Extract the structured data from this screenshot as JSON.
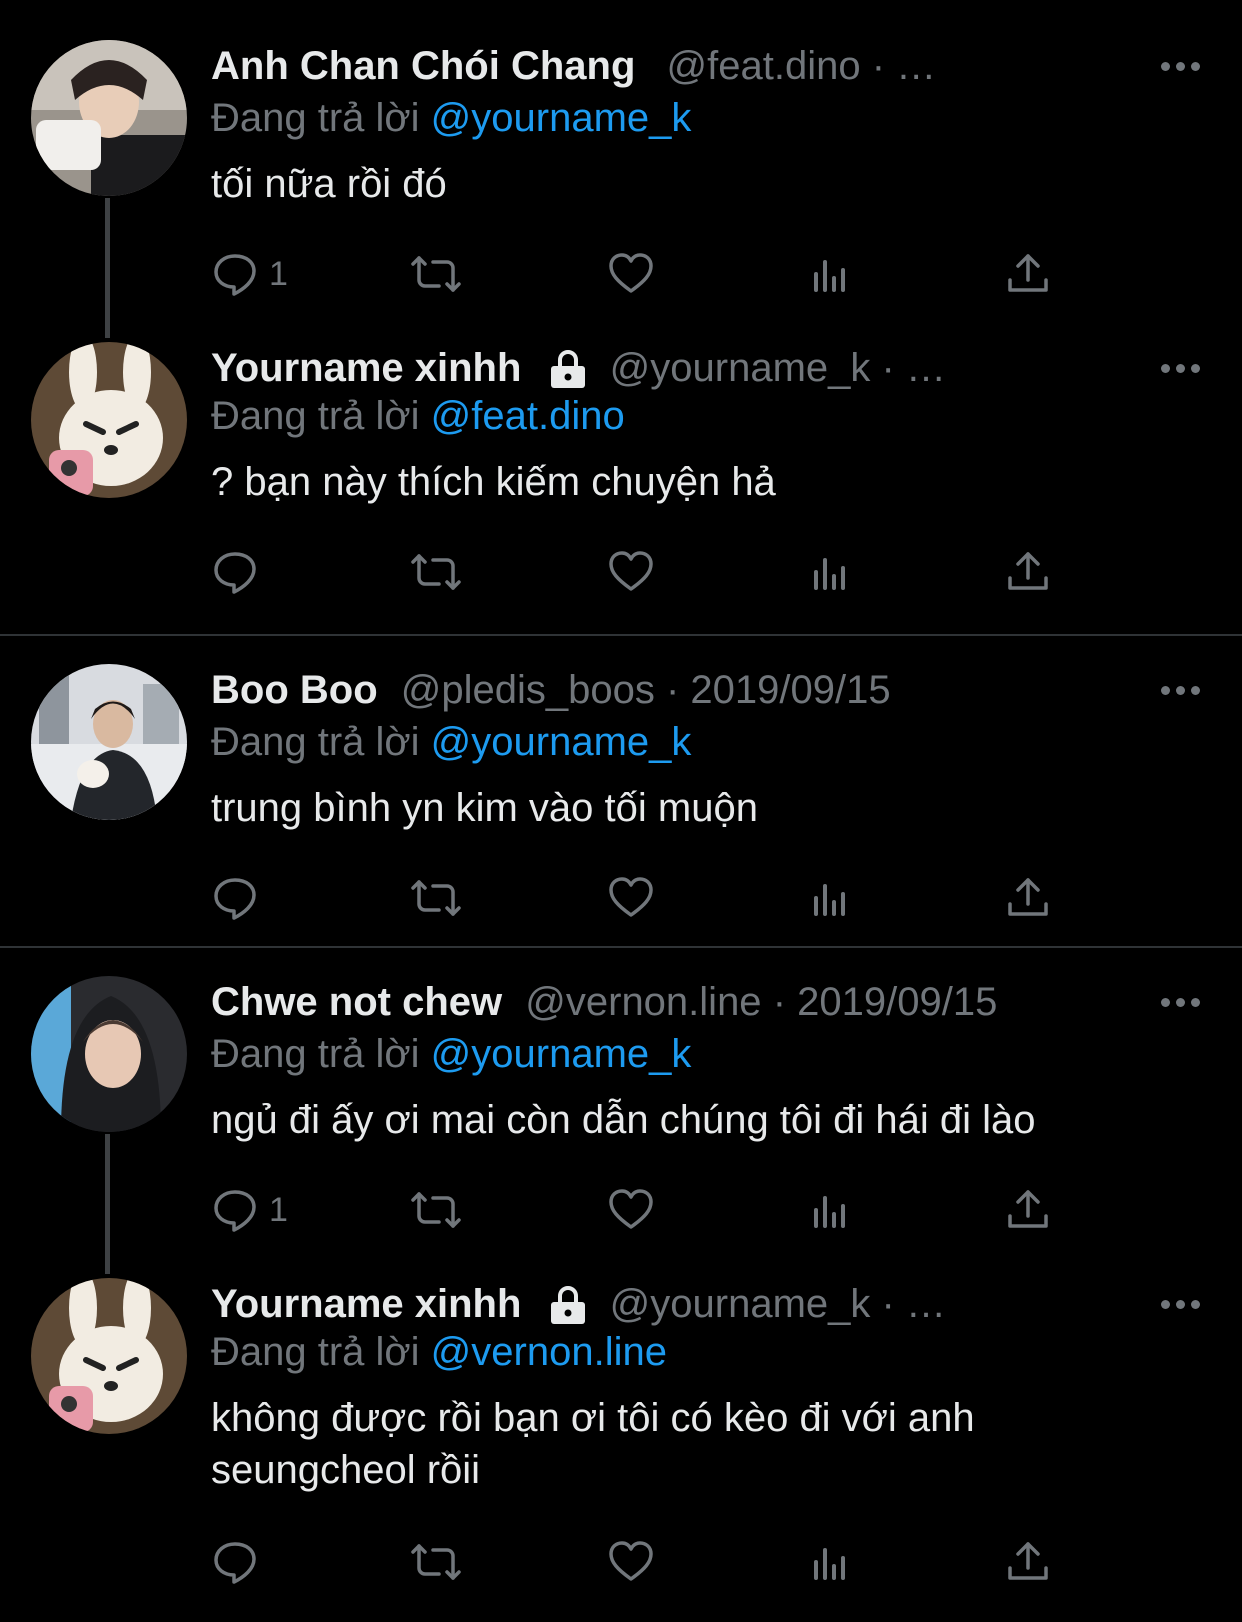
{
  "tweets": [
    {
      "name": "Anh Chan Chói Chang",
      "handle": "@feat.dino",
      "time": "· …",
      "replying_prefix": "Đang trả lời",
      "replying_to": "@yourname_k",
      "text": "tối nữa rồi đó",
      "reply_count": "1",
      "avatar": "person-avatar"
    },
    {
      "name": "Yourname xinhh",
      "handle": "@yourname_k",
      "time": "· …",
      "replying_prefix": "Đang trả lời",
      "replying_to": "@feat.dino",
      "text": "? bạn này thích kiếm chuyện hả",
      "reply_count": "",
      "avatar": "bunny-avatar"
    },
    {
      "name": "Boo Boo",
      "handle": "@pledis_boos",
      "time": "· 2019/09/15",
      "replying_prefix": "Đang trả lời",
      "replying_to": "@yourname_k",
      "text": "trung bình yn kim vào tối muộn",
      "reply_count": "",
      "avatar": "person-avatar"
    },
    {
      "name": "Chwe not chew",
      "handle": "@vernon.line",
      "time": "· 2019/09/15",
      "replying_prefix": "Đang trả lời",
      "replying_to": "@yourname_k",
      "text": "ngủ đi ấy ơi mai còn dẫn chúng tôi đi hái đi lào",
      "reply_count": "1",
      "avatar": "person-avatar"
    },
    {
      "name": "Yourname xinhh",
      "handle": "@yourname_k",
      "time": "· …",
      "replying_prefix": "Đang trả lời",
      "replying_to": "@vernon.line",
      "text_line1": "không được rồi bạn ơi tôi có kèo đi với anh",
      "text_line2": "seungcheol rồii",
      "reply_count": "",
      "avatar": "bunny-avatar"
    }
  ],
  "icons": [
    "reply-icon",
    "retweet-icon",
    "like-icon",
    "views-icon",
    "share-icon",
    "more-icon",
    "lock-icon"
  ],
  "colors": {
    "background": "#000000",
    "text": "#e7e9ea",
    "muted": "#71767b",
    "link": "#1d9bf0"
  }
}
